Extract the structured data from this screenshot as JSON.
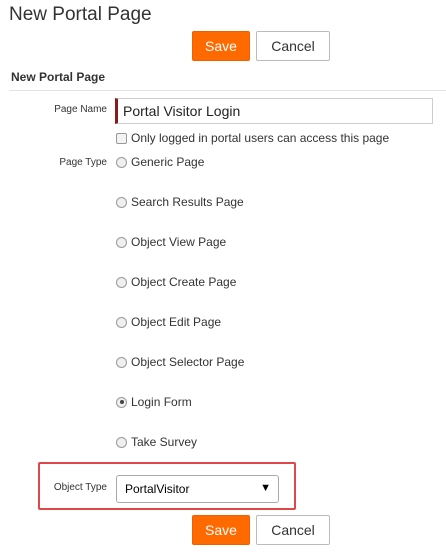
{
  "page": {
    "title": "New Portal Page"
  },
  "toolbar": {
    "save_label": "Save",
    "cancel_label": "Cancel"
  },
  "section": {
    "title": "New Portal Page"
  },
  "form": {
    "page_name": {
      "label": "Page Name",
      "value": "Portal Visitor Login"
    },
    "logged_in_only": {
      "label": "Only logged in portal users can access this page",
      "checked": false
    },
    "page_type": {
      "label": "Page Type",
      "options": [
        "Generic Page",
        "Search Results Page",
        "Object View Page",
        "Object Create Page",
        "Object Edit Page",
        "Object Selector Page",
        "Login Form",
        "Take Survey"
      ],
      "selected": "Login Form"
    },
    "object_type": {
      "label": "Object Type",
      "value": "PortalVisitor"
    }
  },
  "colors": {
    "primary": "#ff6a00",
    "highlight": "#e0474b",
    "required": "#8b1a1a"
  }
}
